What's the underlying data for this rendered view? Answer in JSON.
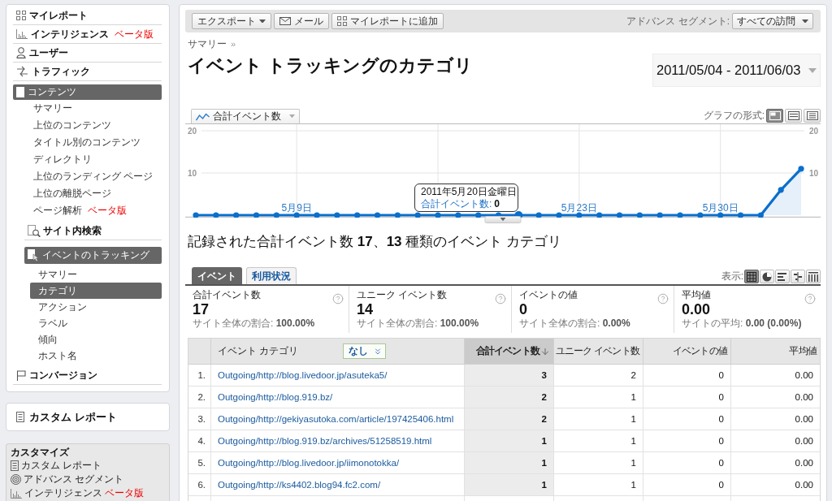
{
  "sidebar": {
    "nav": [
      {
        "label": "マイレポート",
        "selected": false
      },
      {
        "label": "インテリジェンス",
        "badge": "ベータ版",
        "selected": false
      },
      {
        "label": "ユーザー",
        "selected": false
      },
      {
        "label": "トラフィック",
        "selected": false
      },
      {
        "label": "コンテンツ",
        "selected": true,
        "children": [
          {
            "kind": "link",
            "label": "サマリー",
            "selected": false
          },
          {
            "kind": "link",
            "label": "上位のコンテンツ",
            "selected": false
          },
          {
            "kind": "link",
            "label": "タイトル別のコンテンツ",
            "selected": false
          },
          {
            "kind": "link",
            "label": "ディレクトリ",
            "selected": false
          },
          {
            "kind": "link",
            "label": "上位のランディング ページ",
            "selected": false
          },
          {
            "kind": "link",
            "label": "上位の離脱ページ",
            "selected": false
          },
          {
            "kind": "link",
            "label": "ページ解析",
            "badge": "ベータ版",
            "selected": false
          },
          {
            "kind": "section",
            "label": "サイト内検索",
            "selected": false
          },
          {
            "kind": "section",
            "label": "イベントのトラッキング",
            "selected": true,
            "children": [
              {
                "kind": "link",
                "label": "サマリー",
                "selected": false
              },
              {
                "kind": "link",
                "label": "カテゴリ",
                "selected": true
              },
              {
                "kind": "link",
                "label": "アクション",
                "selected": false
              },
              {
                "kind": "link",
                "label": "ラベル",
                "selected": false
              },
              {
                "kind": "link",
                "label": "傾向",
                "selected": false
              },
              {
                "kind": "link",
                "label": "ホスト名",
                "selected": false
              }
            ]
          }
        ]
      },
      {
        "label": "コンバージョン",
        "selected": false
      }
    ]
  },
  "custom_report": {
    "label": "カスタム レポート"
  },
  "customize": {
    "title": "カスタマイズ",
    "items": [
      {
        "label": "カスタム レポート"
      },
      {
        "label": "アドバンス セグメント"
      },
      {
        "label": "インテリジェンス",
        "badge": "ベータ版"
      }
    ]
  },
  "toolbar": {
    "buttons": [
      {
        "kind": "export",
        "label": "エクスポート"
      },
      {
        "kind": "mail",
        "label": "メール"
      },
      {
        "kind": "add",
        "label": "マイレポートに追加"
      }
    ],
    "segment_label": "アドバンス セグメント:",
    "segment": "すべての訪問"
  },
  "breadcrumb": {
    "label": "サマリー",
    "separator": "»"
  },
  "title": "イベント トラッキングのカテゴリ",
  "date_range": "2011/05/04 - 2011/06/03",
  "graph": {
    "format_label": "グラフの形式:",
    "formats": [
      {
        "selected": true
      },
      {
        "selected": false
      },
      {
        "selected": false
      }
    ],
    "chart_data": {
      "type": "area",
      "categories": [
        null,
        null,
        null,
        null,
        null,
        "5月9日",
        null,
        null,
        null,
        null,
        null,
        null,
        null,
        null,
        null,
        null,
        null,
        null,
        null,
        "5月23日",
        null,
        null,
        null,
        null,
        null,
        null,
        "5月30日",
        null,
        null,
        null,
        null
      ],
      "series": [
        {
          "name": "合計イベント数",
          "color": "#0a6fcc",
          "values": [
            0,
            0,
            0,
            0,
            0,
            0,
            0,
            0,
            0,
            0,
            0,
            0,
            0,
            0,
            0,
            0,
            0,
            0,
            0,
            0,
            0,
            0,
            0,
            0,
            0,
            0,
            0,
            0,
            0,
            6,
            11
          ]
        }
      ],
      "ylim": [
        0,
        20
      ],
      "yticks": [
        10,
        20
      ],
      "grid": true
    },
    "right_axis": [
      "20",
      "10"
    ],
    "tooltip": {
      "date": "2011年5月20日金曜日",
      "label": "合計イベント数:",
      "value": "0"
    }
  },
  "summary": "記録された合計イベント数 **17**、**13** 種類のイベント カテゴリ",
  "tabs": [
    {
      "label": "イベント",
      "selected": true
    },
    {
      "label": "利用状況",
      "selected": false
    }
  ],
  "view_label": "表示:",
  "views": [
    {
      "selected": true
    },
    {
      "selected": false
    },
    {
      "selected": false
    },
    {
      "selected": false
    },
    {
      "selected": false
    }
  ],
  "metrics": [
    {
      "label": "合計イベント数",
      "value": "17",
      "note": "サイト全体の割合: **100.00%**"
    },
    {
      "label": "ユニーク イベント数",
      "value": "14",
      "note": "サイト全体の割合: **100.00%**"
    },
    {
      "label": "イベントの値",
      "value": "0",
      "note": "サイト全体の割合: **0.00%**"
    },
    {
      "label": "平均値",
      "value": "0.00",
      "note": "サイトの平均: **0.00 (0.00%)**"
    }
  ],
  "table": {
    "filter": "なし",
    "columns": [
      {
        "label": "イベント カテゴリ",
        "sorted": false
      },
      {
        "label": "合計イベント数",
        "sorted": true
      },
      {
        "label": "ユニーク イベント数",
        "sorted": false
      },
      {
        "label": "イベントの値",
        "sorted": false
      },
      {
        "label": "平均値",
        "sorted": false
      }
    ],
    "rows": [
      {
        "number": "1.",
        "category": "Outgoing/http://blog.livedoor.jp/asuteka5/",
        "values": [
          "3",
          "2",
          "0",
          "0.00"
        ]
      },
      {
        "number": "2.",
        "category": "Outgoing/http://blog.919.bz/",
        "values": [
          "2",
          "1",
          "0",
          "0.00"
        ]
      },
      {
        "number": "3.",
        "category": "Outgoing/http://gekiyasutoka.com/article/197425406.html",
        "values": [
          "2",
          "1",
          "0",
          "0.00"
        ]
      },
      {
        "number": "4.",
        "category": "Outgoing/http://blog.919.bz/archives/51258519.html",
        "values": [
          "1",
          "1",
          "0",
          "0.00"
        ]
      },
      {
        "number": "5.",
        "category": "Outgoing/http://blog.livedoor.jp/iimonotokka/",
        "values": [
          "1",
          "1",
          "0",
          "0.00"
        ]
      },
      {
        "number": "6.",
        "category": "Outgoing/http://ks4402.blog94.fc2.com/",
        "values": [
          "1",
          "1",
          "0",
          "0.00"
        ]
      }
    ]
  }
}
